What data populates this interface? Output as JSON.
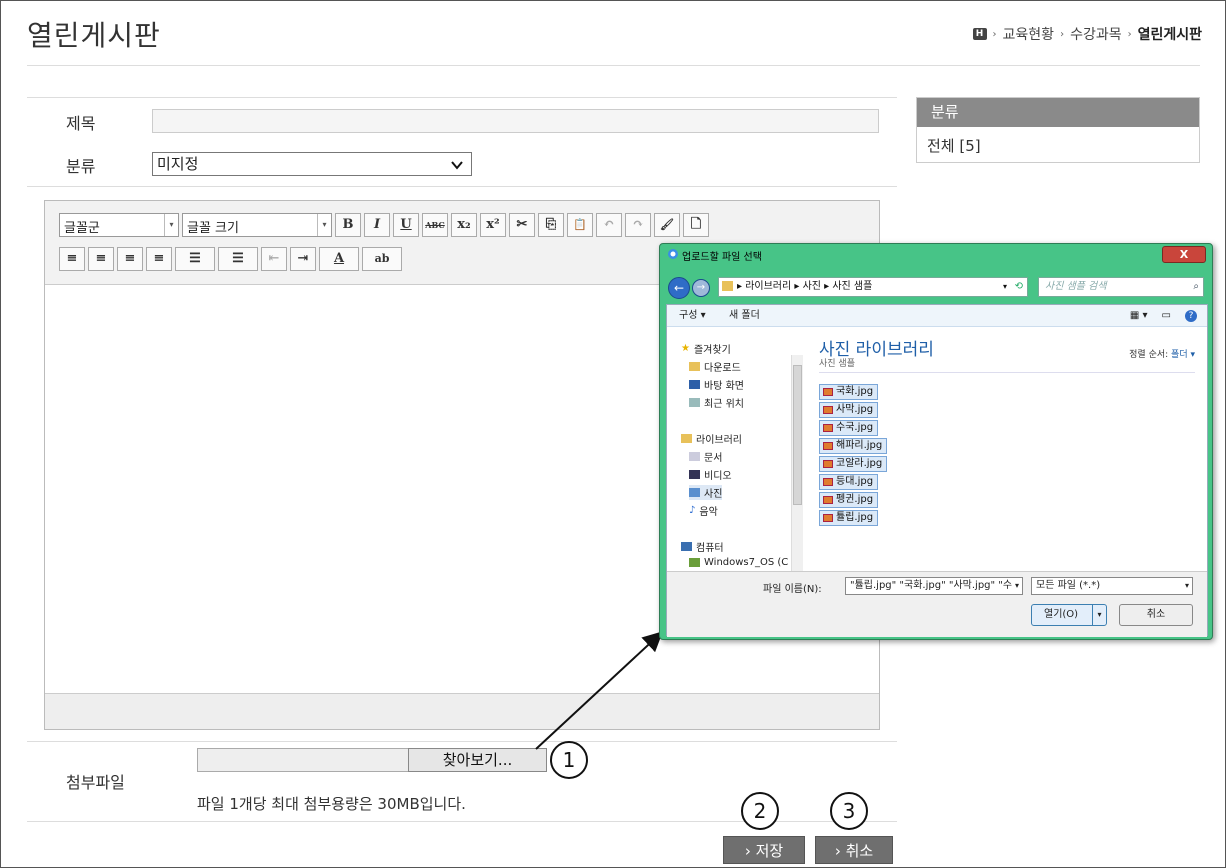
{
  "page": {
    "title": "열린게시판",
    "breadcrumb": [
      "교육현황",
      "수강과목",
      "열린게시판"
    ],
    "home_icon_text": "H"
  },
  "form": {
    "subject_label": "제목",
    "subject_value": "",
    "category_label": "분류",
    "category_value": "미지정",
    "attach_label": "첨부파일",
    "browse_label": "찾아보기...",
    "attach_note": "파일 1개당 최대 첨부용량은 30MB입니다.",
    "save_label": "› 저장",
    "cancel_label": "› 취소"
  },
  "category_panel": {
    "heading": "분류",
    "items": [
      "전체 [5]"
    ]
  },
  "editor": {
    "font_family_placeholder": "글꼴군",
    "font_size_placeholder": "글꼴 크기",
    "buttons_row1": [
      "B",
      "I",
      "U",
      "ABC",
      "x₂",
      "x²",
      "✂",
      "⎘",
      "📋",
      "↶",
      "↷",
      "🖌",
      "🗋"
    ],
    "buttons_row2": [
      "≡",
      "≡",
      "≡",
      "≡",
      "☰",
      "☰",
      "⇤",
      "⇥",
      "A",
      "ab"
    ]
  },
  "callouts": [
    "1",
    "2",
    "3"
  ],
  "dialog": {
    "title": "업로드할 파일 선택",
    "close_label": "X",
    "address_path": "▸ 라이브러리 ▸ 사진 ▸ 사진 샘플",
    "search_placeholder": "사진 샘플 검색",
    "cmd_organize": "구성 ▾",
    "cmd_new_folder": "새 폴더",
    "nav": {
      "favorites": "즐겨찾기",
      "downloads": "다운로드",
      "desktop": "바탕 화면",
      "recent": "최근 위치",
      "libraries": "라이브러리",
      "documents": "문서",
      "videos": "비디오",
      "pictures": "사진",
      "music": "음악",
      "computer": "컴퓨터",
      "drive": "Windows7_OS (C"
    },
    "library_title": "사진 라이브러리",
    "library_subtitle": "사진 샘플",
    "sort_label": "정렬 순서:",
    "sort_value": "폴더 ▾",
    "files": [
      "국화.jpg",
      "사막.jpg",
      "수국.jpg",
      "해파리.jpg",
      "코알라.jpg",
      "등대.jpg",
      "펭귄.jpg",
      "튤립.jpg"
    ],
    "filename_label": "파일 이름(N):",
    "filename_value": "\"튤립.jpg\" \"국화.jpg\" \"사막.jpg\" \"수",
    "filetype_value": "모든 파일 (*.*)",
    "open_label": "열기(O)",
    "cancel_label": "취소"
  }
}
